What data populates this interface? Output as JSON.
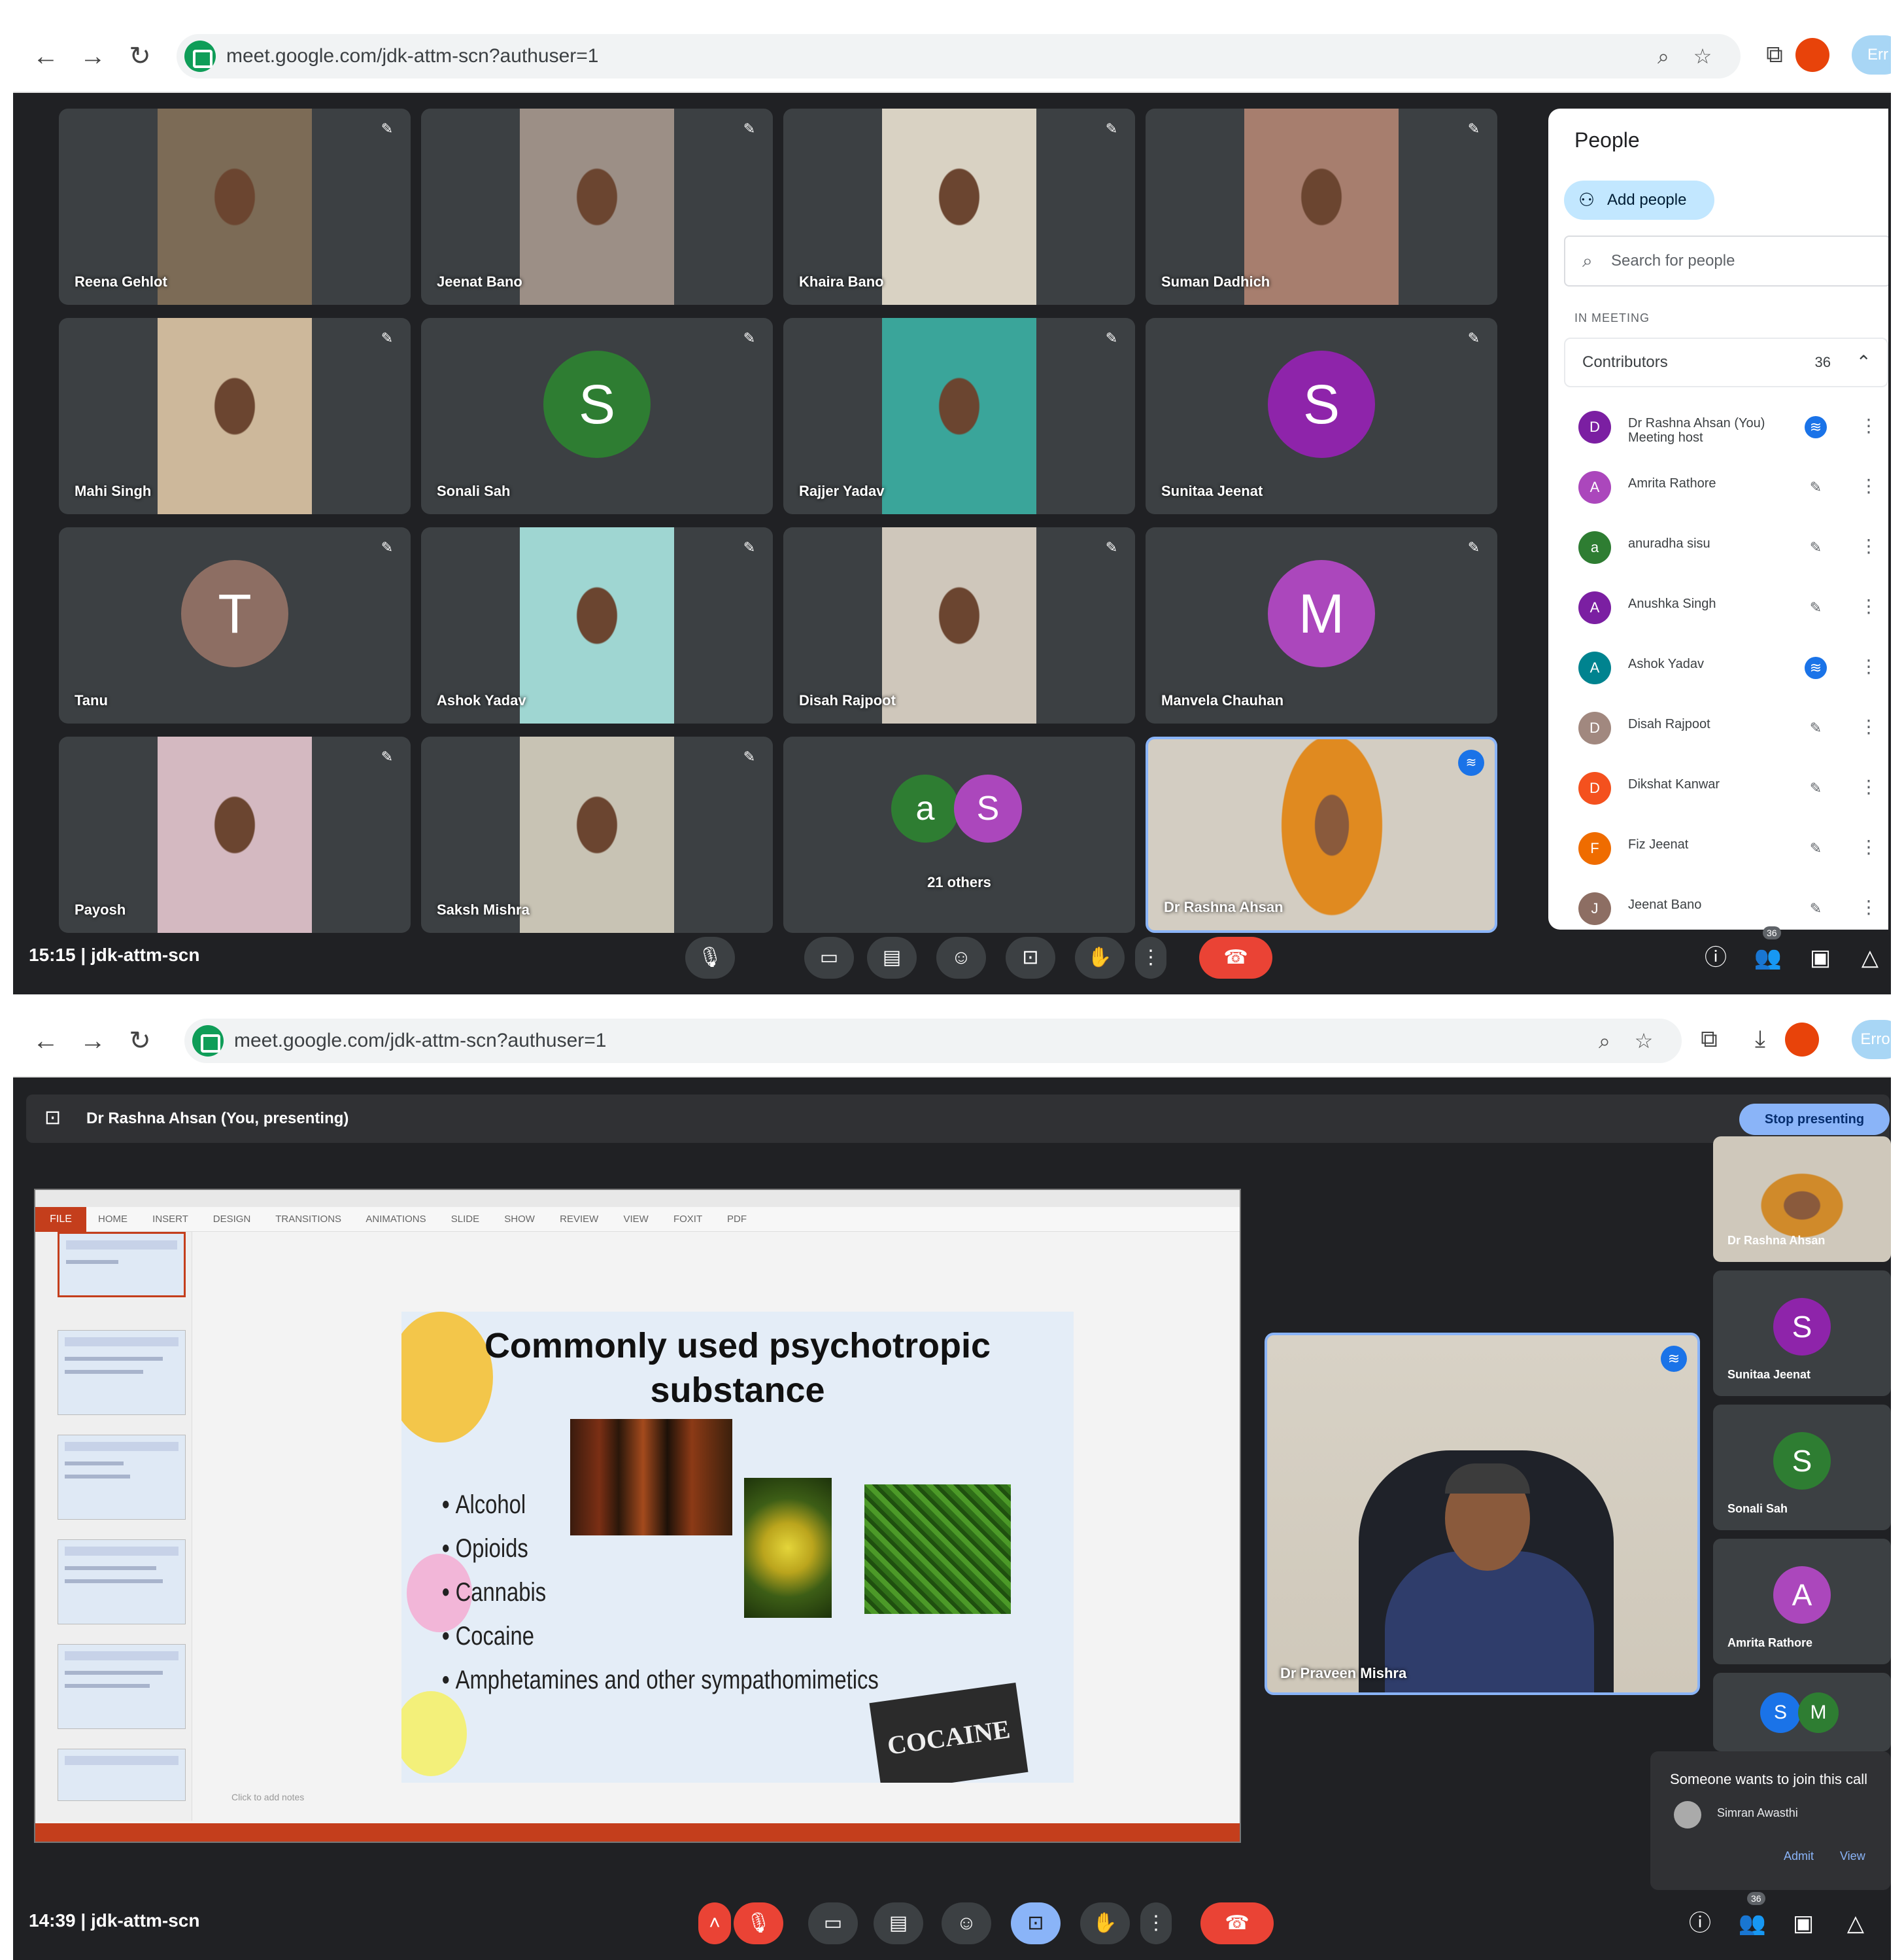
{
  "screen1": {
    "browser": {
      "url": "meet.google.com/jdk-attm-scn?authuser=1",
      "profile_label": "Err"
    },
    "tiles": [
      {
        "name": "Reena Gehlot",
        "kind": "video",
        "bg": "#7c6b56"
      },
      {
        "name": "Jeenat Bano",
        "kind": "video",
        "bg": "#9c8f86"
      },
      {
        "name": "Khaira Bano",
        "kind": "video",
        "bg": "#d9d2c3"
      },
      {
        "name": "Suman Dadhich",
        "kind": "video",
        "bg": "#a77e6e"
      },
      {
        "name": "Mahi Singh",
        "kind": "video",
        "bg": "#cdb89b"
      },
      {
        "name": "Sonali Sah",
        "kind": "avatar",
        "letter": "S",
        "color": "#2e7d32"
      },
      {
        "name": "Rajjer Yadav",
        "kind": "video",
        "bg": "#3aa59a"
      },
      {
        "name": "Sunitaa Jeenat",
        "kind": "avatar",
        "letter": "S",
        "color": "#8e24aa"
      },
      {
        "name": "Tanu",
        "kind": "avatar",
        "letter": "T",
        "color": "#8d6e63"
      },
      {
        "name": "Ashok Yadav",
        "kind": "video",
        "bg": "#9fd6d2"
      },
      {
        "name": "Disah Rajpoot",
        "kind": "video",
        "bg": "#cfc7bb"
      },
      {
        "name": "Manvela Chauhan",
        "kind": "avatar",
        "letter": "M",
        "color": "#ab47bc"
      },
      {
        "name": "Payosh",
        "kind": "video",
        "bg": "#d4b9c1"
      },
      {
        "name": "Saksh Mishra",
        "kind": "video",
        "bg": "#c8c3b4"
      },
      {
        "name": "21 others",
        "kind": "others",
        "letters": [
          "a",
          "S"
        ],
        "colors": [
          "#2e7d32",
          "#ab47bc"
        ]
      },
      {
        "name": "Dr Rashna Ahsan",
        "kind": "self",
        "bg": "#d3cdc2"
      }
    ],
    "people_panel": {
      "title": "People",
      "add_button": "Add people",
      "search_placeholder": "Search for people",
      "section": "IN MEETING",
      "group_label": "Contributors",
      "group_count": "36",
      "participants": [
        {
          "initial": "D",
          "name": "Dr Rashna Ahsan (You) Meeting host",
          "color": "#7b1fa2",
          "state": "talk"
        },
        {
          "initial": "A",
          "name": "Amrita Rathore",
          "color": "#ab47bc",
          "state": "muted"
        },
        {
          "initial": "a",
          "name": "anuradha sisu",
          "color": "#2e7d32",
          "state": "muted"
        },
        {
          "initial": "A",
          "name": "Anushka Singh",
          "color": "#7b1fa2",
          "state": "muted"
        },
        {
          "initial": "A",
          "name": "Ashok Yadav",
          "color": "#00838f",
          "state": "talk"
        },
        {
          "initial": "D",
          "name": "Disah Rajpoot",
          "color": "#a1887f",
          "state": "muted"
        },
        {
          "initial": "D",
          "name": "Dikshat Kanwar",
          "color": "#f4511e",
          "state": "muted"
        },
        {
          "initial": "F",
          "name": "Fiz Jeenat",
          "color": "#ef6c00",
          "state": "muted"
        },
        {
          "initial": "J",
          "name": "Jeenat Bano",
          "color": "#8d6e63",
          "state": "muted"
        }
      ]
    },
    "bottom": {
      "meeting_info": "15:15 | jdk-attm-scn",
      "badge": "36"
    }
  },
  "screen2": {
    "browser": {
      "url": "meet.google.com/jdk-attm-scn?authuser=1",
      "profile_label": "Error"
    },
    "presenting_label": "Dr Rashna Ahsan (You, presenting)",
    "stop_button": "Stop presenting",
    "ppt": {
      "file_tab": "FILE",
      "tabs": "HOME INSERT DESIGN TRANSITIONS ANIMATIONS SLIDE SHOW REVIEW VIEW FOXIT PDF",
      "notes_hint": "Click to add notes"
    },
    "slide": {
      "title": "Commonly used psychotropic substance",
      "bullets": [
        "Alcohol",
        "Opioids",
        "Cannabis",
        "Cocaine",
        "Amphetamines and other sympathomimetics"
      ],
      "image_text": "COCAINE"
    },
    "speaker": {
      "name": "Dr Praveen Mishra"
    },
    "side_tiles": [
      {
        "name": "Dr Rashna Ahsan",
        "kind": "video"
      },
      {
        "name": "Sunitaa Jeenat",
        "kind": "avatar",
        "letter": "S",
        "color": "#8e24aa"
      },
      {
        "name": "Sonali Sah",
        "kind": "avatar",
        "letter": "S",
        "color": "#2e7d32"
      },
      {
        "name": "Amrita Rathore",
        "kind": "avatar",
        "letter": "A",
        "color": "#ab47bc"
      }
    ],
    "others": {
      "letters": [
        "S",
        "M"
      ],
      "colors": [
        "#1a73e8",
        "#2e7d32"
      ]
    },
    "notification": {
      "text": "Someone wants to join this call",
      "name": "Simran Awasthi",
      "admit": "Admit",
      "view": "View"
    },
    "bottom": {
      "meeting_info": "14:39 | jdk-attm-scn",
      "badge": "36"
    }
  }
}
